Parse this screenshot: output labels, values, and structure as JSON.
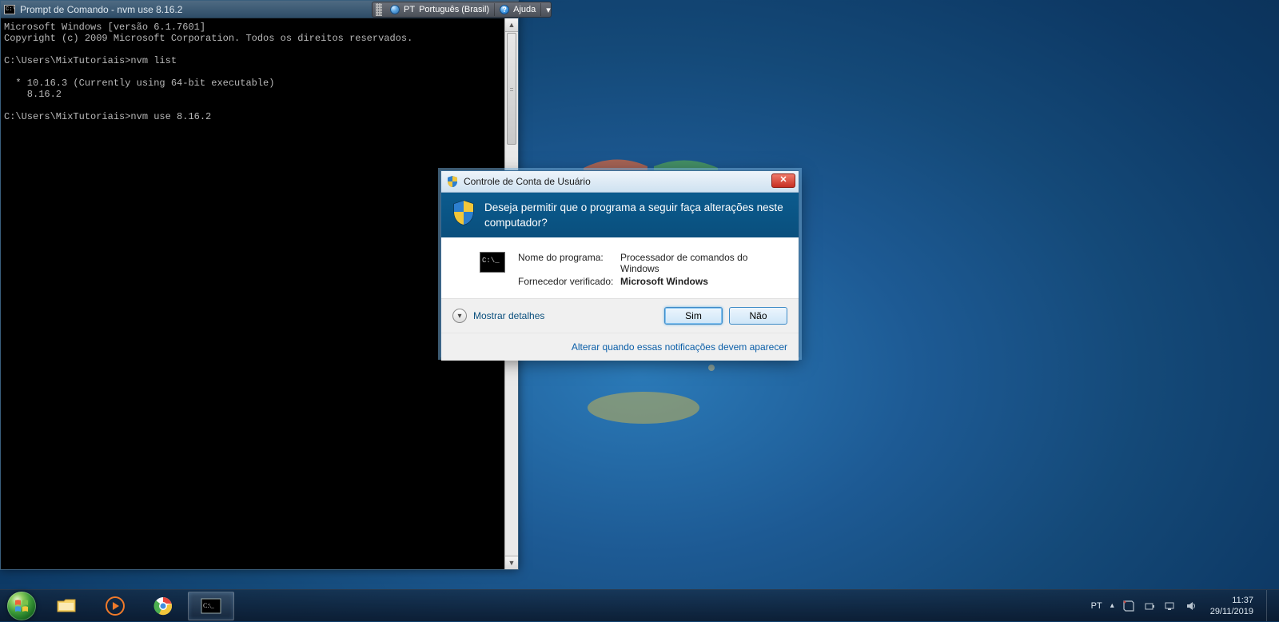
{
  "langbar": {
    "grip": true,
    "code": "PT",
    "lang": "Português (Brasil)",
    "help": "Ajuda",
    "help_mark": "?"
  },
  "cmd_window": {
    "title": "Prompt de Comando - nvm  use 8.16.2",
    "lines": [
      "Microsoft Windows [versão 6.1.7601]",
      "Copyright (c) 2009 Microsoft Corporation. Todos os direitos reservados.",
      "",
      "C:\\Users\\MixTutoriais>nvm list",
      "",
      "  * 10.16.3 (Currently using 64-bit executable)",
      "    8.16.2",
      "",
      "C:\\Users\\MixTutoriais>nvm use 8.16.2",
      ""
    ],
    "scrollbar": {
      "up": "▲",
      "down": "▼"
    }
  },
  "uac": {
    "title": "Controle de Conta de Usuário",
    "close": "✕",
    "message": "Deseja permitir que o programa a seguir faça alterações neste computador?",
    "program_label": "Nome do programa:",
    "program_value": "Processador de comandos do Windows",
    "vendor_label": "Fornecedor verificado:",
    "vendor_value": "Microsoft Windows",
    "details": "Mostrar detalhes",
    "yes": "Sim",
    "no": "Não",
    "notify_link": "Alterar quando essas notificações devem aparecer"
  },
  "taskbar": {
    "tray_lang": "PT",
    "time": "11:37",
    "date": "29/11/2019"
  }
}
